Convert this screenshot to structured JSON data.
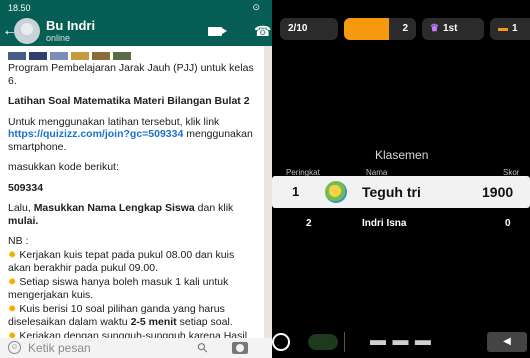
{
  "status_bar": {
    "time": "18.50",
    "right_icon": "signal-icon"
  },
  "chat": {
    "contact_name": "Bu Indri",
    "contact_status": "online",
    "message": {
      "p1": "Program Pembelajaran Jarak Jauh (PJJ) untuk kelas 6.",
      "title": "Latihan Soal Matematika Materi Bilangan Bulat 2",
      "p3_before": "Untuk menggunakan latihan tersebut, klik link ",
      "p3_link": "https://quizizz.com/join?gc=509334",
      "p3_after": " menggunakan smartphone.",
      "p4": "masukkan kode berikut:",
      "code": "509334",
      "p6_a": "Lalu, ",
      "p6_b": "Masukkan Nama Lengkap Siswa",
      "p6_c": " dan klik ",
      "p6_d": "mulai.",
      "nb": "NB :",
      "item1": "Kerjakan kuis tepat pada pukul 08.00 dan kuis akan berakhir pada pukul 09.00.",
      "item2": "Setiap siswa hanya boleh masuk 1 kali untuk mengerjakan kuis.",
      "item3_a": "Kuis berisi 10 soal pilihan ganda yang harus diselesaikan dalam waktu ",
      "item3_b": "2-5 menit",
      "item3_c": " setiap soal.",
      "item4": "Kerjakan dengan sungguh-sungguh karena Hasil Kuis akan dinilai."
    },
    "input_placeholder": "Ketik pesan"
  },
  "game": {
    "question_counter": "2/10",
    "score_value": "2",
    "score_progress": 0.62,
    "rank_label": "1st",
    "streak_label": "1",
    "leaderboard_title": "Klasemen",
    "columns": {
      "rank": "Peringkat",
      "name": "Nama",
      "score": "Skor"
    },
    "rows": [
      {
        "rank": "1",
        "name": "Teguh tri",
        "score": "1900"
      },
      {
        "rank": "2",
        "name": "Indri Isna",
        "score": "0"
      }
    ]
  },
  "colors": {
    "whatsapp_green": "#075e54",
    "chat_bg": "#ece5dd",
    "link": "#1a73c9",
    "score_orange": "#f59a0e",
    "rank_purple": "#c77dff"
  }
}
